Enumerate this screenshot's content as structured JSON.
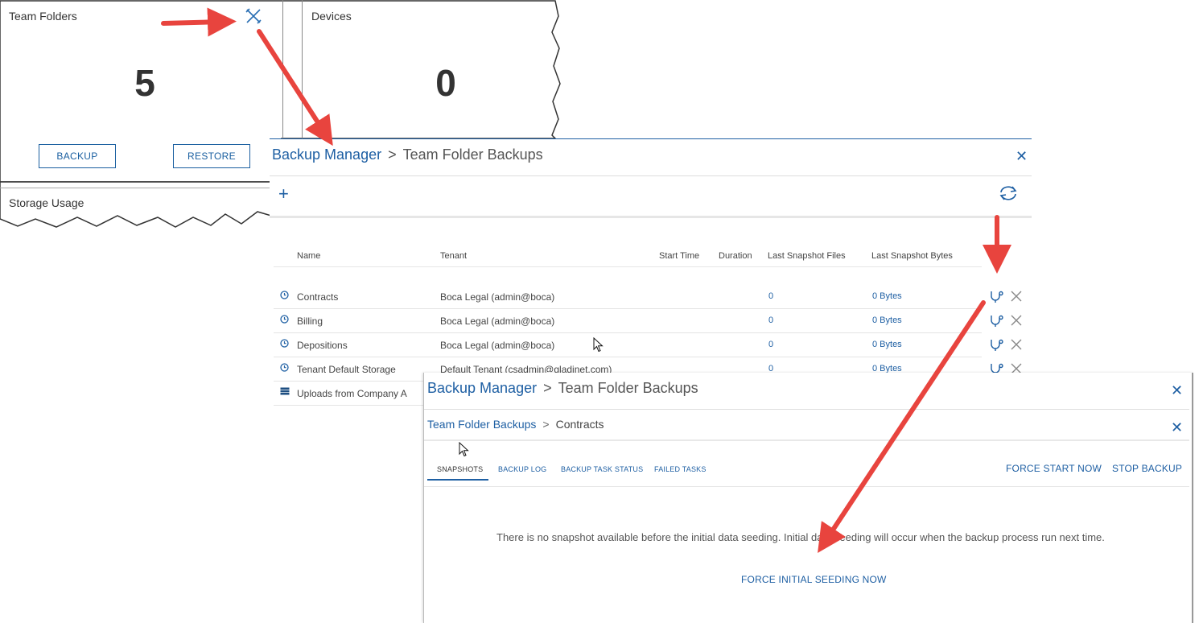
{
  "cards": {
    "team_folders": {
      "title": "Team Folders",
      "count": "5",
      "backup_label": "BACKUP",
      "restore_label": "RESTORE"
    },
    "devices": {
      "title": "Devices",
      "count": "0"
    },
    "storage_usage": {
      "title": "Storage Usage"
    }
  },
  "panel_top": {
    "breadcrumb_root": "Backup Manager",
    "breadcrumb_sep": ">",
    "breadcrumb_current": "Team Folder Backups",
    "add_label": "+",
    "columns": [
      "Name",
      "Tenant",
      "Start Time",
      "Duration",
      "Last Snapshot Files",
      "Last Snapshot Bytes"
    ],
    "rows": [
      {
        "name": "Contracts",
        "tenant": "Boca Legal (admin@boca)",
        "files": "0",
        "bytes": "0 Bytes"
      },
      {
        "name": "Billing",
        "tenant": "Boca Legal (admin@boca)",
        "files": "0",
        "bytes": "0 Bytes"
      },
      {
        "name": "Depositions",
        "tenant": "Boca Legal (admin@boca)",
        "files": "0",
        "bytes": "0 Bytes"
      },
      {
        "name": "Tenant Default Storage",
        "tenant": "Default Tenant (csadmin@gladinet.com)",
        "files": "0",
        "bytes": "0 Bytes"
      },
      {
        "name": "Uploads from Company A"
      }
    ]
  },
  "panel_bottom": {
    "breadcrumb_root": "Backup Manager",
    "breadcrumb_sep": ">",
    "breadcrumb_current": "Team Folder Backups",
    "sub_root": "Team Folder Backups",
    "sub_sep": ">",
    "sub_current": "Contracts",
    "tabs": [
      "SNAPSHOTS",
      "BACKUP LOG",
      "BACKUP TASK STATUS",
      "FAILED TASKS"
    ],
    "force_start_label": "FORCE START NOW",
    "stop_backup_label": "STOP BACKUP",
    "message": "There is no snapshot available before the initial data seeding. Initial data seeding will occur when the backup process run next time.",
    "force_seed_label": "FORCE INITIAL SEEDING NOW"
  },
  "colors": {
    "accent": "#1e5fa3",
    "arrow": "#e8443e"
  }
}
